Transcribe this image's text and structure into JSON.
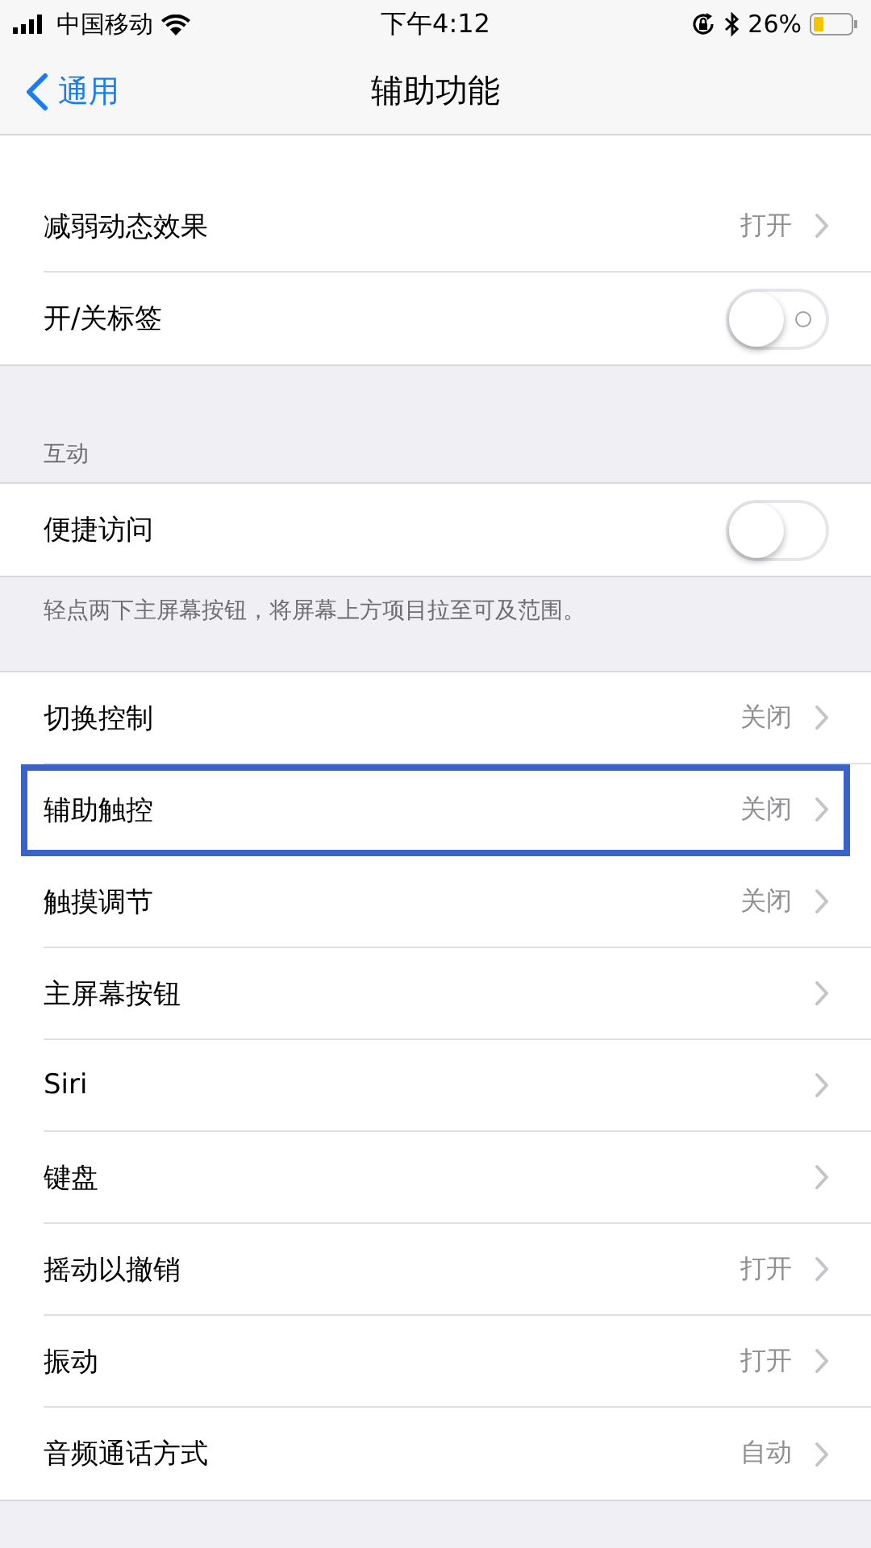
{
  "status_bar": {
    "carrier": "中国移动",
    "time": "下午4:12",
    "battery": "26%"
  },
  "nav": {
    "back": "通用",
    "title": "辅助功能"
  },
  "sections": [
    {
      "rows": [
        {
          "kind": "link",
          "label": "减弱动态效果",
          "value": "打开"
        },
        {
          "kind": "toggle",
          "label": "开/关标签",
          "on": false,
          "off_label": true
        }
      ]
    },
    {
      "header": "互动",
      "footer": "轻点两下主屏幕按钮，将屏幕上方项目拉至可及范围。",
      "rows": [
        {
          "kind": "toggle",
          "label": "便捷访问",
          "on": false,
          "off_label": false
        }
      ]
    },
    {
      "rows": [
        {
          "kind": "link",
          "label": "切换控制",
          "value": "关闭"
        },
        {
          "kind": "link",
          "label": "辅助触控",
          "value": "关闭",
          "highlighted": true
        },
        {
          "kind": "link",
          "label": "触摸调节",
          "value": "关闭"
        },
        {
          "kind": "link",
          "label": "主屏幕按钮"
        },
        {
          "kind": "link",
          "label": "Siri"
        },
        {
          "kind": "link",
          "label": "键盘"
        },
        {
          "kind": "link",
          "label": "摇动以撤销",
          "value": "打开"
        },
        {
          "kind": "link",
          "label": "振动",
          "value": "打开"
        },
        {
          "kind": "link",
          "label": "音频通话方式",
          "value": "自动"
        }
      ]
    }
  ]
}
